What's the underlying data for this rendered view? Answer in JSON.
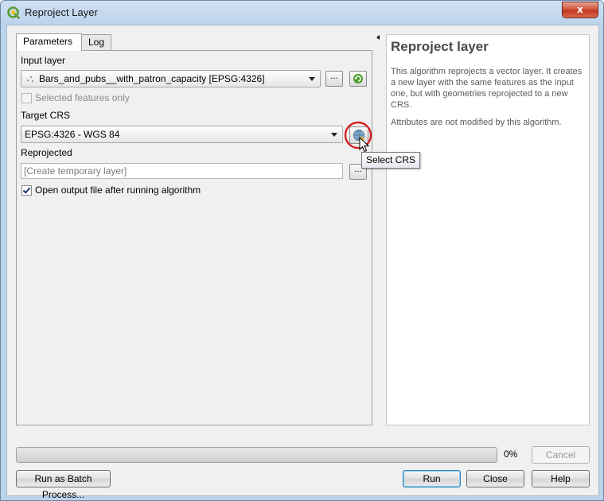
{
  "window": {
    "title": "Reproject Layer",
    "close_label": "x"
  },
  "tabs": [
    {
      "label": "Parameters",
      "active": true
    },
    {
      "label": "Log",
      "active": false
    }
  ],
  "params": {
    "input_layer_label": "Input layer",
    "input_layer_value": "Bars_and_pubs__with_patron_capacity [EPSG:4326]",
    "browse_label": "...",
    "selected_only_label": "Selected features only",
    "selected_only_checked": false,
    "target_crs_label": "Target CRS",
    "target_crs_value": "EPSG:4326 - WGS 84",
    "reprojected_label": "Reprojected",
    "reprojected_placeholder": "[Create temporary layer]",
    "open_output_label": "Open output file after running algorithm",
    "open_output_checked": true
  },
  "help": {
    "title": "Reproject layer",
    "paragraph1": "This algorithm reprojects a vector layer. It creates a new layer with the same features as the input one, but with geometries reprojected to a new CRS.",
    "paragraph2": "Attributes are not modified by this algorithm."
  },
  "progress": {
    "value": 0,
    "label": "0%"
  },
  "buttons": {
    "cancel": "Cancel",
    "batch": "Run as Batch Process...",
    "run": "Run",
    "close": "Close",
    "help": "Help"
  },
  "tooltip": "Select CRS",
  "colors": {
    "highlight_ring": "#d62020",
    "accent": "#3c7fb1"
  }
}
